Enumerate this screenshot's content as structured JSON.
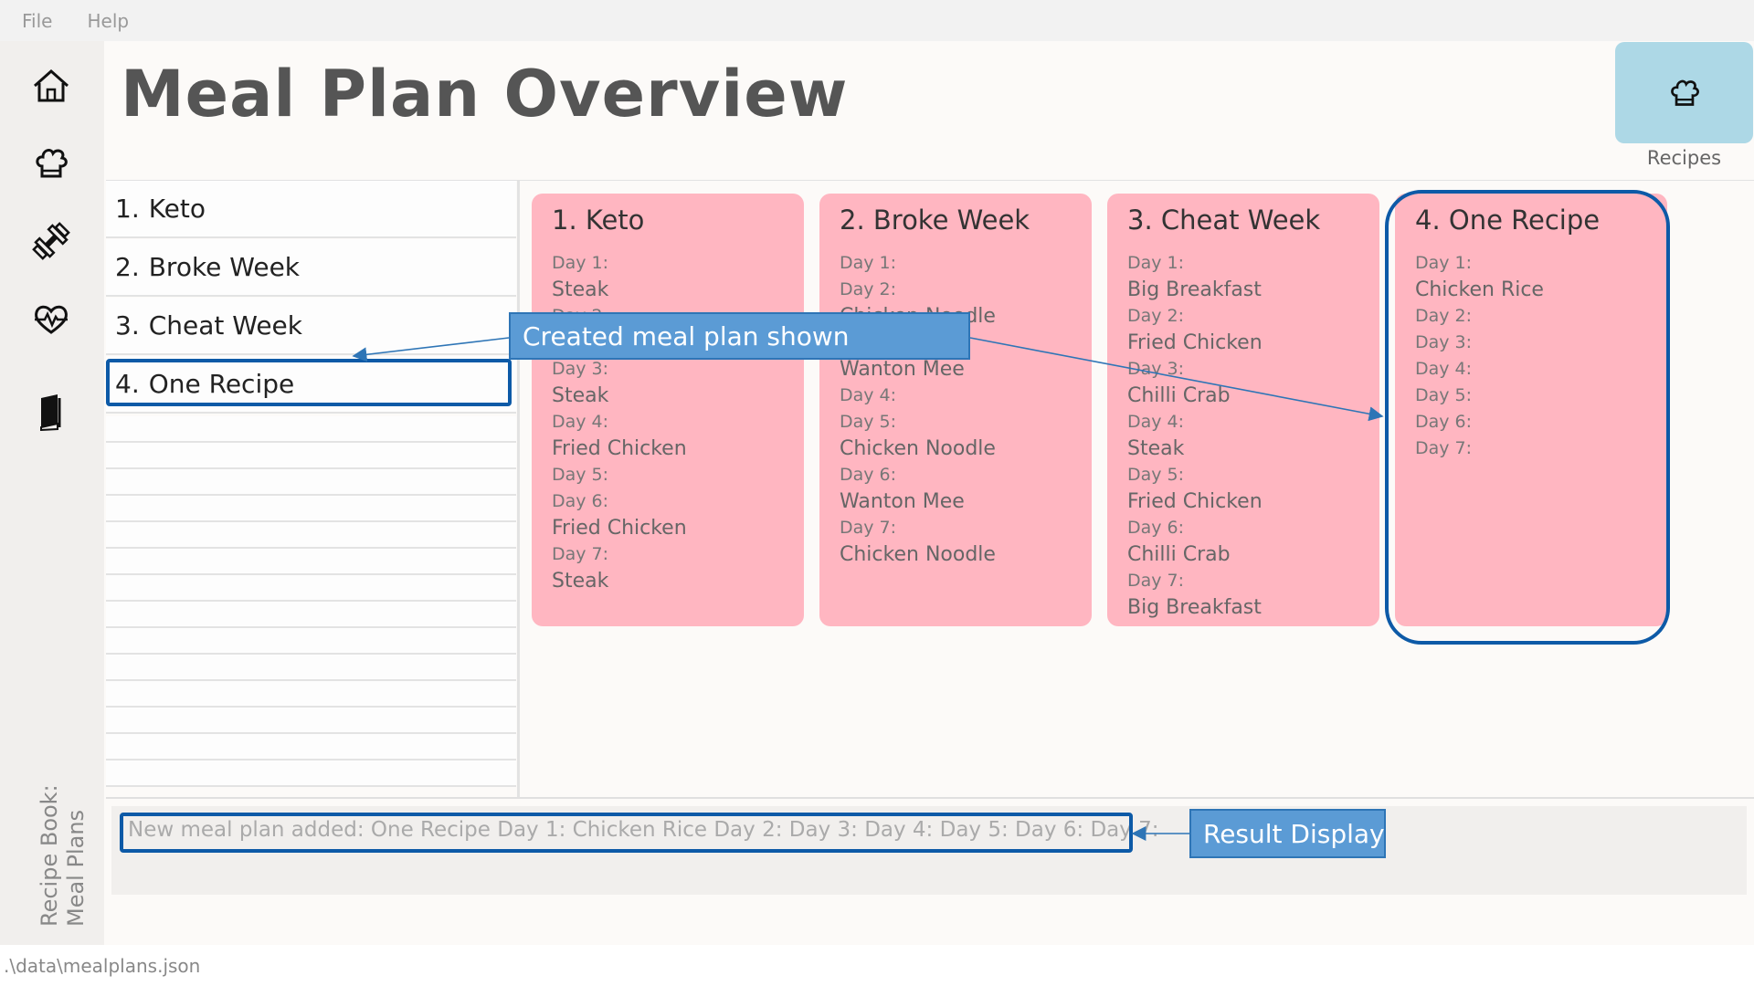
{
  "menu": {
    "file": "File",
    "help": "Help"
  },
  "sidebar": {
    "icons": [
      "home-icon",
      "chef-hat-icon",
      "dumbbell-icon",
      "heartbeat-icon",
      "book-icon"
    ],
    "label_line1": "Recipe Book:",
    "label_line2": "Meal Plans"
  },
  "header": {
    "title": "Meal Plan Overview",
    "recipes_tab_label": "Recipes"
  },
  "meal_list": [
    {
      "num": "1.",
      "name": "Keto"
    },
    {
      "num": "2.",
      "name": "Broke Week"
    },
    {
      "num": "3.",
      "name": "Cheat Week"
    },
    {
      "num": "4.",
      "name": "One Recipe"
    }
  ],
  "cards": [
    {
      "title": "1.  Keto",
      "lines": [
        {
          "t": "Day 1:",
          "k": "day"
        },
        {
          "t": "Steak",
          "k": "meal"
        },
        {
          "t": "Day 2:",
          "k": "day"
        },
        {
          "t": "",
          "k": "meal"
        },
        {
          "t": "Day 3:",
          "k": "day"
        },
        {
          "t": "Steak",
          "k": "meal"
        },
        {
          "t": "Day 4:",
          "k": "day"
        },
        {
          "t": "Fried Chicken",
          "k": "meal"
        },
        {
          "t": "Day 5:",
          "k": "day"
        },
        {
          "t": "Day 6:",
          "k": "day"
        },
        {
          "t": "Fried Chicken",
          "k": "meal"
        },
        {
          "t": "Day 7:",
          "k": "day"
        },
        {
          "t": "Steak",
          "k": "meal"
        }
      ]
    },
    {
      "title": "2.  Broke Week",
      "lines": [
        {
          "t": "Day 1:",
          "k": "day"
        },
        {
          "t": "Day 2:",
          "k": "day"
        },
        {
          "t": "Chicken Noodle",
          "k": "meal"
        },
        {
          "t": "Day 3:",
          "k": "day"
        },
        {
          "t": "Wanton Mee",
          "k": "meal"
        },
        {
          "t": "Day 4:",
          "k": "day"
        },
        {
          "t": "Day 5:",
          "k": "day"
        },
        {
          "t": "Chicken Noodle",
          "k": "meal"
        },
        {
          "t": "Day 6:",
          "k": "day"
        },
        {
          "t": "Wanton Mee",
          "k": "meal"
        },
        {
          "t": "Day 7:",
          "k": "day"
        },
        {
          "t": "Chicken Noodle",
          "k": "meal"
        }
      ]
    },
    {
      "title": "3.  Cheat Week",
      "lines": [
        {
          "t": "Day 1:",
          "k": "day"
        },
        {
          "t": "Big Breakfast",
          "k": "meal"
        },
        {
          "t": "Day 2:",
          "k": "day"
        },
        {
          "t": "Fried Chicken",
          "k": "meal"
        },
        {
          "t": "Day 3:",
          "k": "day"
        },
        {
          "t": "Chilli Crab",
          "k": "meal"
        },
        {
          "t": "Day 4:",
          "k": "day"
        },
        {
          "t": "Steak",
          "k": "meal"
        },
        {
          "t": "Day 5:",
          "k": "day"
        },
        {
          "t": "Fried Chicken",
          "k": "meal"
        },
        {
          "t": "Day 6:",
          "k": "day"
        },
        {
          "t": "Chilli Crab",
          "k": "meal"
        },
        {
          "t": "Day 7:",
          "k": "day"
        },
        {
          "t": "Big Breakfast",
          "k": "meal"
        }
      ]
    },
    {
      "title": "4.  One Recipe",
      "lines": [
        {
          "t": "Day 1:",
          "k": "day"
        },
        {
          "t": "Chicken Rice",
          "k": "meal"
        },
        {
          "t": "Day 2:",
          "k": "day"
        },
        {
          "t": "Day 3:",
          "k": "day"
        },
        {
          "t": "Day 4:",
          "k": "day"
        },
        {
          "t": "Day 5:",
          "k": "day"
        },
        {
          "t": "Day 6:",
          "k": "day"
        },
        {
          "t": "Day 7:",
          "k": "day"
        }
      ]
    }
  ],
  "result_display": "New meal plan added: One Recipe Day 1: Chicken Rice Day 2:  Day 3:  Day 4:  Day 5:  Day 6:  Day 7:",
  "status_bar": ".\\data\\mealplans.json",
  "annotations": {
    "created_callout": "Created meal plan shown",
    "result_callout": "Result Display"
  },
  "colors": {
    "card_bg": "#ffb6c1",
    "tab_bg": "#add8e6",
    "highlight": "#0d5aa7",
    "callout_bg": "#5b9bd5"
  }
}
